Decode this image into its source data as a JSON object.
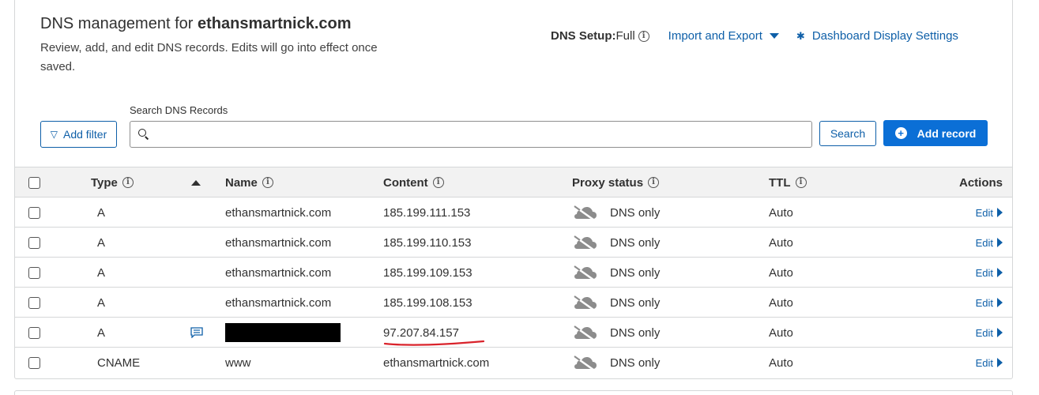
{
  "header": {
    "title_prefix": "DNS management for ",
    "domain": "ethansmartnick.com",
    "subtitle": "Review, add, and edit DNS records. Edits will go into effect once saved.",
    "dns_setup_label": "DNS Setup:",
    "dns_setup_value": "Full",
    "import_export": "Import and Export",
    "dashboard_settings": "Dashboard Display Settings"
  },
  "toolbar": {
    "add_filter": "Add filter",
    "search_label": "Search DNS Records",
    "search_value": "",
    "search_button": "Search",
    "add_record": "Add record"
  },
  "table": {
    "columns": {
      "type": "Type",
      "name": "Name",
      "content": "Content",
      "proxy": "Proxy status",
      "ttl": "TTL",
      "actions": "Actions"
    },
    "rows": [
      {
        "type": "A",
        "name": "ethansmartnick.com",
        "content": "185.199.111.153",
        "proxy": "DNS only",
        "ttl": "Auto",
        "action": "Edit"
      },
      {
        "type": "A",
        "name": "ethansmartnick.com",
        "content": "185.199.110.153",
        "proxy": "DNS only",
        "ttl": "Auto",
        "action": "Edit"
      },
      {
        "type": "A",
        "name": "ethansmartnick.com",
        "content": "185.199.109.153",
        "proxy": "DNS only",
        "ttl": "Auto",
        "action": "Edit"
      },
      {
        "type": "A",
        "name": "ethansmartnick.com",
        "content": "185.199.108.153",
        "proxy": "DNS only",
        "ttl": "Auto",
        "action": "Edit"
      },
      {
        "type": "A",
        "name": "",
        "content": "97.207.84.157",
        "proxy": "DNS only",
        "ttl": "Auto",
        "action": "Edit"
      },
      {
        "type": "CNAME",
        "name": "www",
        "content": "ethansmartnick.com",
        "proxy": "DNS only",
        "ttl": "Auto",
        "action": "Edit"
      }
    ]
  },
  "icons": {
    "info": "info-circle-icon",
    "cloud": "cloud-dns-only-icon",
    "note": "comment-icon",
    "gear": "gear-icon",
    "filter": "filter-icon",
    "search": "search-icon"
  },
  "colors": {
    "link": "#0e5fa8",
    "primary_button": "#0b6fd6",
    "annotation_red": "#d9232b",
    "cloud_gray": "#8c8c8c"
  }
}
